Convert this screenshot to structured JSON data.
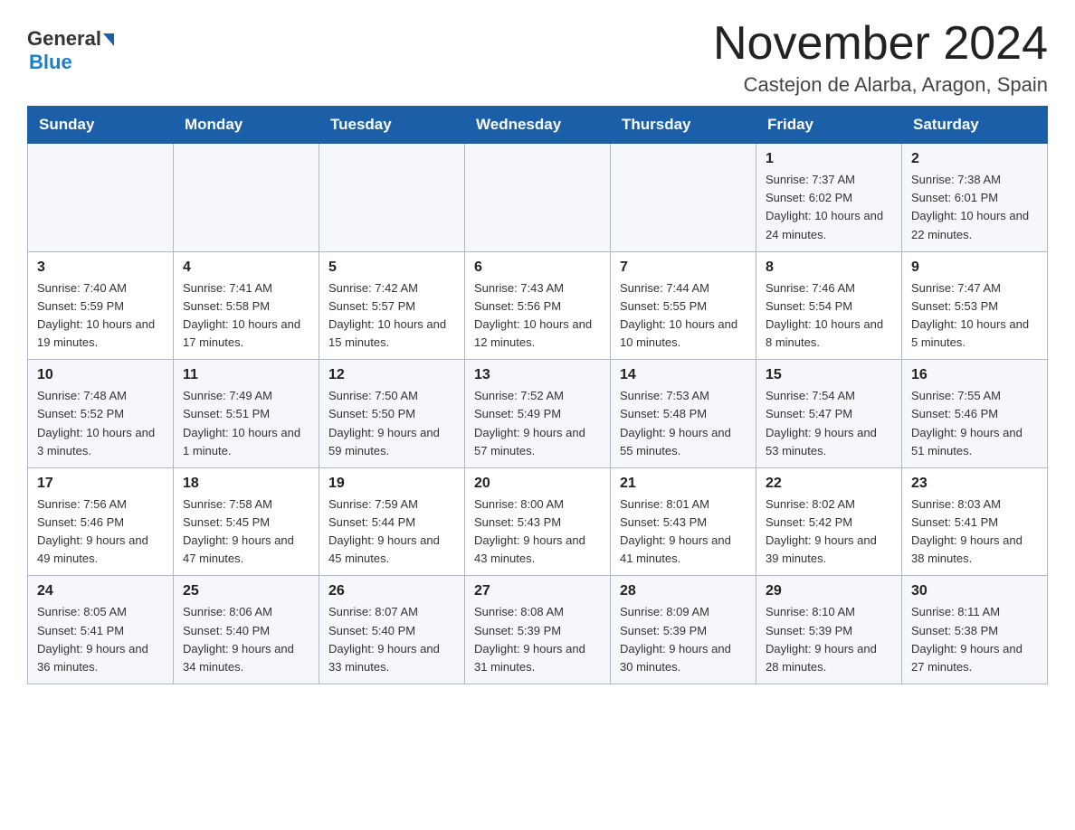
{
  "header": {
    "logo": {
      "general": "General",
      "blue": "Blue"
    },
    "title": "November 2024",
    "subtitle": "Castejon de Alarba, Aragon, Spain"
  },
  "calendar": {
    "days_of_week": [
      "Sunday",
      "Monday",
      "Tuesday",
      "Wednesday",
      "Thursday",
      "Friday",
      "Saturday"
    ],
    "weeks": [
      [
        {
          "day": "",
          "sunrise": "",
          "sunset": "",
          "daylight": ""
        },
        {
          "day": "",
          "sunrise": "",
          "sunset": "",
          "daylight": ""
        },
        {
          "day": "",
          "sunrise": "",
          "sunset": "",
          "daylight": ""
        },
        {
          "day": "",
          "sunrise": "",
          "sunset": "",
          "daylight": ""
        },
        {
          "day": "",
          "sunrise": "",
          "sunset": "",
          "daylight": ""
        },
        {
          "day": "1",
          "sunrise": "Sunrise: 7:37 AM",
          "sunset": "Sunset: 6:02 PM",
          "daylight": "Daylight: 10 hours and 24 minutes."
        },
        {
          "day": "2",
          "sunrise": "Sunrise: 7:38 AM",
          "sunset": "Sunset: 6:01 PM",
          "daylight": "Daylight: 10 hours and 22 minutes."
        }
      ],
      [
        {
          "day": "3",
          "sunrise": "Sunrise: 7:40 AM",
          "sunset": "Sunset: 5:59 PM",
          "daylight": "Daylight: 10 hours and 19 minutes."
        },
        {
          "day": "4",
          "sunrise": "Sunrise: 7:41 AM",
          "sunset": "Sunset: 5:58 PM",
          "daylight": "Daylight: 10 hours and 17 minutes."
        },
        {
          "day": "5",
          "sunrise": "Sunrise: 7:42 AM",
          "sunset": "Sunset: 5:57 PM",
          "daylight": "Daylight: 10 hours and 15 minutes."
        },
        {
          "day": "6",
          "sunrise": "Sunrise: 7:43 AM",
          "sunset": "Sunset: 5:56 PM",
          "daylight": "Daylight: 10 hours and 12 minutes."
        },
        {
          "day": "7",
          "sunrise": "Sunrise: 7:44 AM",
          "sunset": "Sunset: 5:55 PM",
          "daylight": "Daylight: 10 hours and 10 minutes."
        },
        {
          "day": "8",
          "sunrise": "Sunrise: 7:46 AM",
          "sunset": "Sunset: 5:54 PM",
          "daylight": "Daylight: 10 hours and 8 minutes."
        },
        {
          "day": "9",
          "sunrise": "Sunrise: 7:47 AM",
          "sunset": "Sunset: 5:53 PM",
          "daylight": "Daylight: 10 hours and 5 minutes."
        }
      ],
      [
        {
          "day": "10",
          "sunrise": "Sunrise: 7:48 AM",
          "sunset": "Sunset: 5:52 PM",
          "daylight": "Daylight: 10 hours and 3 minutes."
        },
        {
          "day": "11",
          "sunrise": "Sunrise: 7:49 AM",
          "sunset": "Sunset: 5:51 PM",
          "daylight": "Daylight: 10 hours and 1 minute."
        },
        {
          "day": "12",
          "sunrise": "Sunrise: 7:50 AM",
          "sunset": "Sunset: 5:50 PM",
          "daylight": "Daylight: 9 hours and 59 minutes."
        },
        {
          "day": "13",
          "sunrise": "Sunrise: 7:52 AM",
          "sunset": "Sunset: 5:49 PM",
          "daylight": "Daylight: 9 hours and 57 minutes."
        },
        {
          "day": "14",
          "sunrise": "Sunrise: 7:53 AM",
          "sunset": "Sunset: 5:48 PM",
          "daylight": "Daylight: 9 hours and 55 minutes."
        },
        {
          "day": "15",
          "sunrise": "Sunrise: 7:54 AM",
          "sunset": "Sunset: 5:47 PM",
          "daylight": "Daylight: 9 hours and 53 minutes."
        },
        {
          "day": "16",
          "sunrise": "Sunrise: 7:55 AM",
          "sunset": "Sunset: 5:46 PM",
          "daylight": "Daylight: 9 hours and 51 minutes."
        }
      ],
      [
        {
          "day": "17",
          "sunrise": "Sunrise: 7:56 AM",
          "sunset": "Sunset: 5:46 PM",
          "daylight": "Daylight: 9 hours and 49 minutes."
        },
        {
          "day": "18",
          "sunrise": "Sunrise: 7:58 AM",
          "sunset": "Sunset: 5:45 PM",
          "daylight": "Daylight: 9 hours and 47 minutes."
        },
        {
          "day": "19",
          "sunrise": "Sunrise: 7:59 AM",
          "sunset": "Sunset: 5:44 PM",
          "daylight": "Daylight: 9 hours and 45 minutes."
        },
        {
          "day": "20",
          "sunrise": "Sunrise: 8:00 AM",
          "sunset": "Sunset: 5:43 PM",
          "daylight": "Daylight: 9 hours and 43 minutes."
        },
        {
          "day": "21",
          "sunrise": "Sunrise: 8:01 AM",
          "sunset": "Sunset: 5:43 PM",
          "daylight": "Daylight: 9 hours and 41 minutes."
        },
        {
          "day": "22",
          "sunrise": "Sunrise: 8:02 AM",
          "sunset": "Sunset: 5:42 PM",
          "daylight": "Daylight: 9 hours and 39 minutes."
        },
        {
          "day": "23",
          "sunrise": "Sunrise: 8:03 AM",
          "sunset": "Sunset: 5:41 PM",
          "daylight": "Daylight: 9 hours and 38 minutes."
        }
      ],
      [
        {
          "day": "24",
          "sunrise": "Sunrise: 8:05 AM",
          "sunset": "Sunset: 5:41 PM",
          "daylight": "Daylight: 9 hours and 36 minutes."
        },
        {
          "day": "25",
          "sunrise": "Sunrise: 8:06 AM",
          "sunset": "Sunset: 5:40 PM",
          "daylight": "Daylight: 9 hours and 34 minutes."
        },
        {
          "day": "26",
          "sunrise": "Sunrise: 8:07 AM",
          "sunset": "Sunset: 5:40 PM",
          "daylight": "Daylight: 9 hours and 33 minutes."
        },
        {
          "day": "27",
          "sunrise": "Sunrise: 8:08 AM",
          "sunset": "Sunset: 5:39 PM",
          "daylight": "Daylight: 9 hours and 31 minutes."
        },
        {
          "day": "28",
          "sunrise": "Sunrise: 8:09 AM",
          "sunset": "Sunset: 5:39 PM",
          "daylight": "Daylight: 9 hours and 30 minutes."
        },
        {
          "day": "29",
          "sunrise": "Sunrise: 8:10 AM",
          "sunset": "Sunset: 5:39 PM",
          "daylight": "Daylight: 9 hours and 28 minutes."
        },
        {
          "day": "30",
          "sunrise": "Sunrise: 8:11 AM",
          "sunset": "Sunset: 5:38 PM",
          "daylight": "Daylight: 9 hours and 27 minutes."
        }
      ]
    ]
  }
}
